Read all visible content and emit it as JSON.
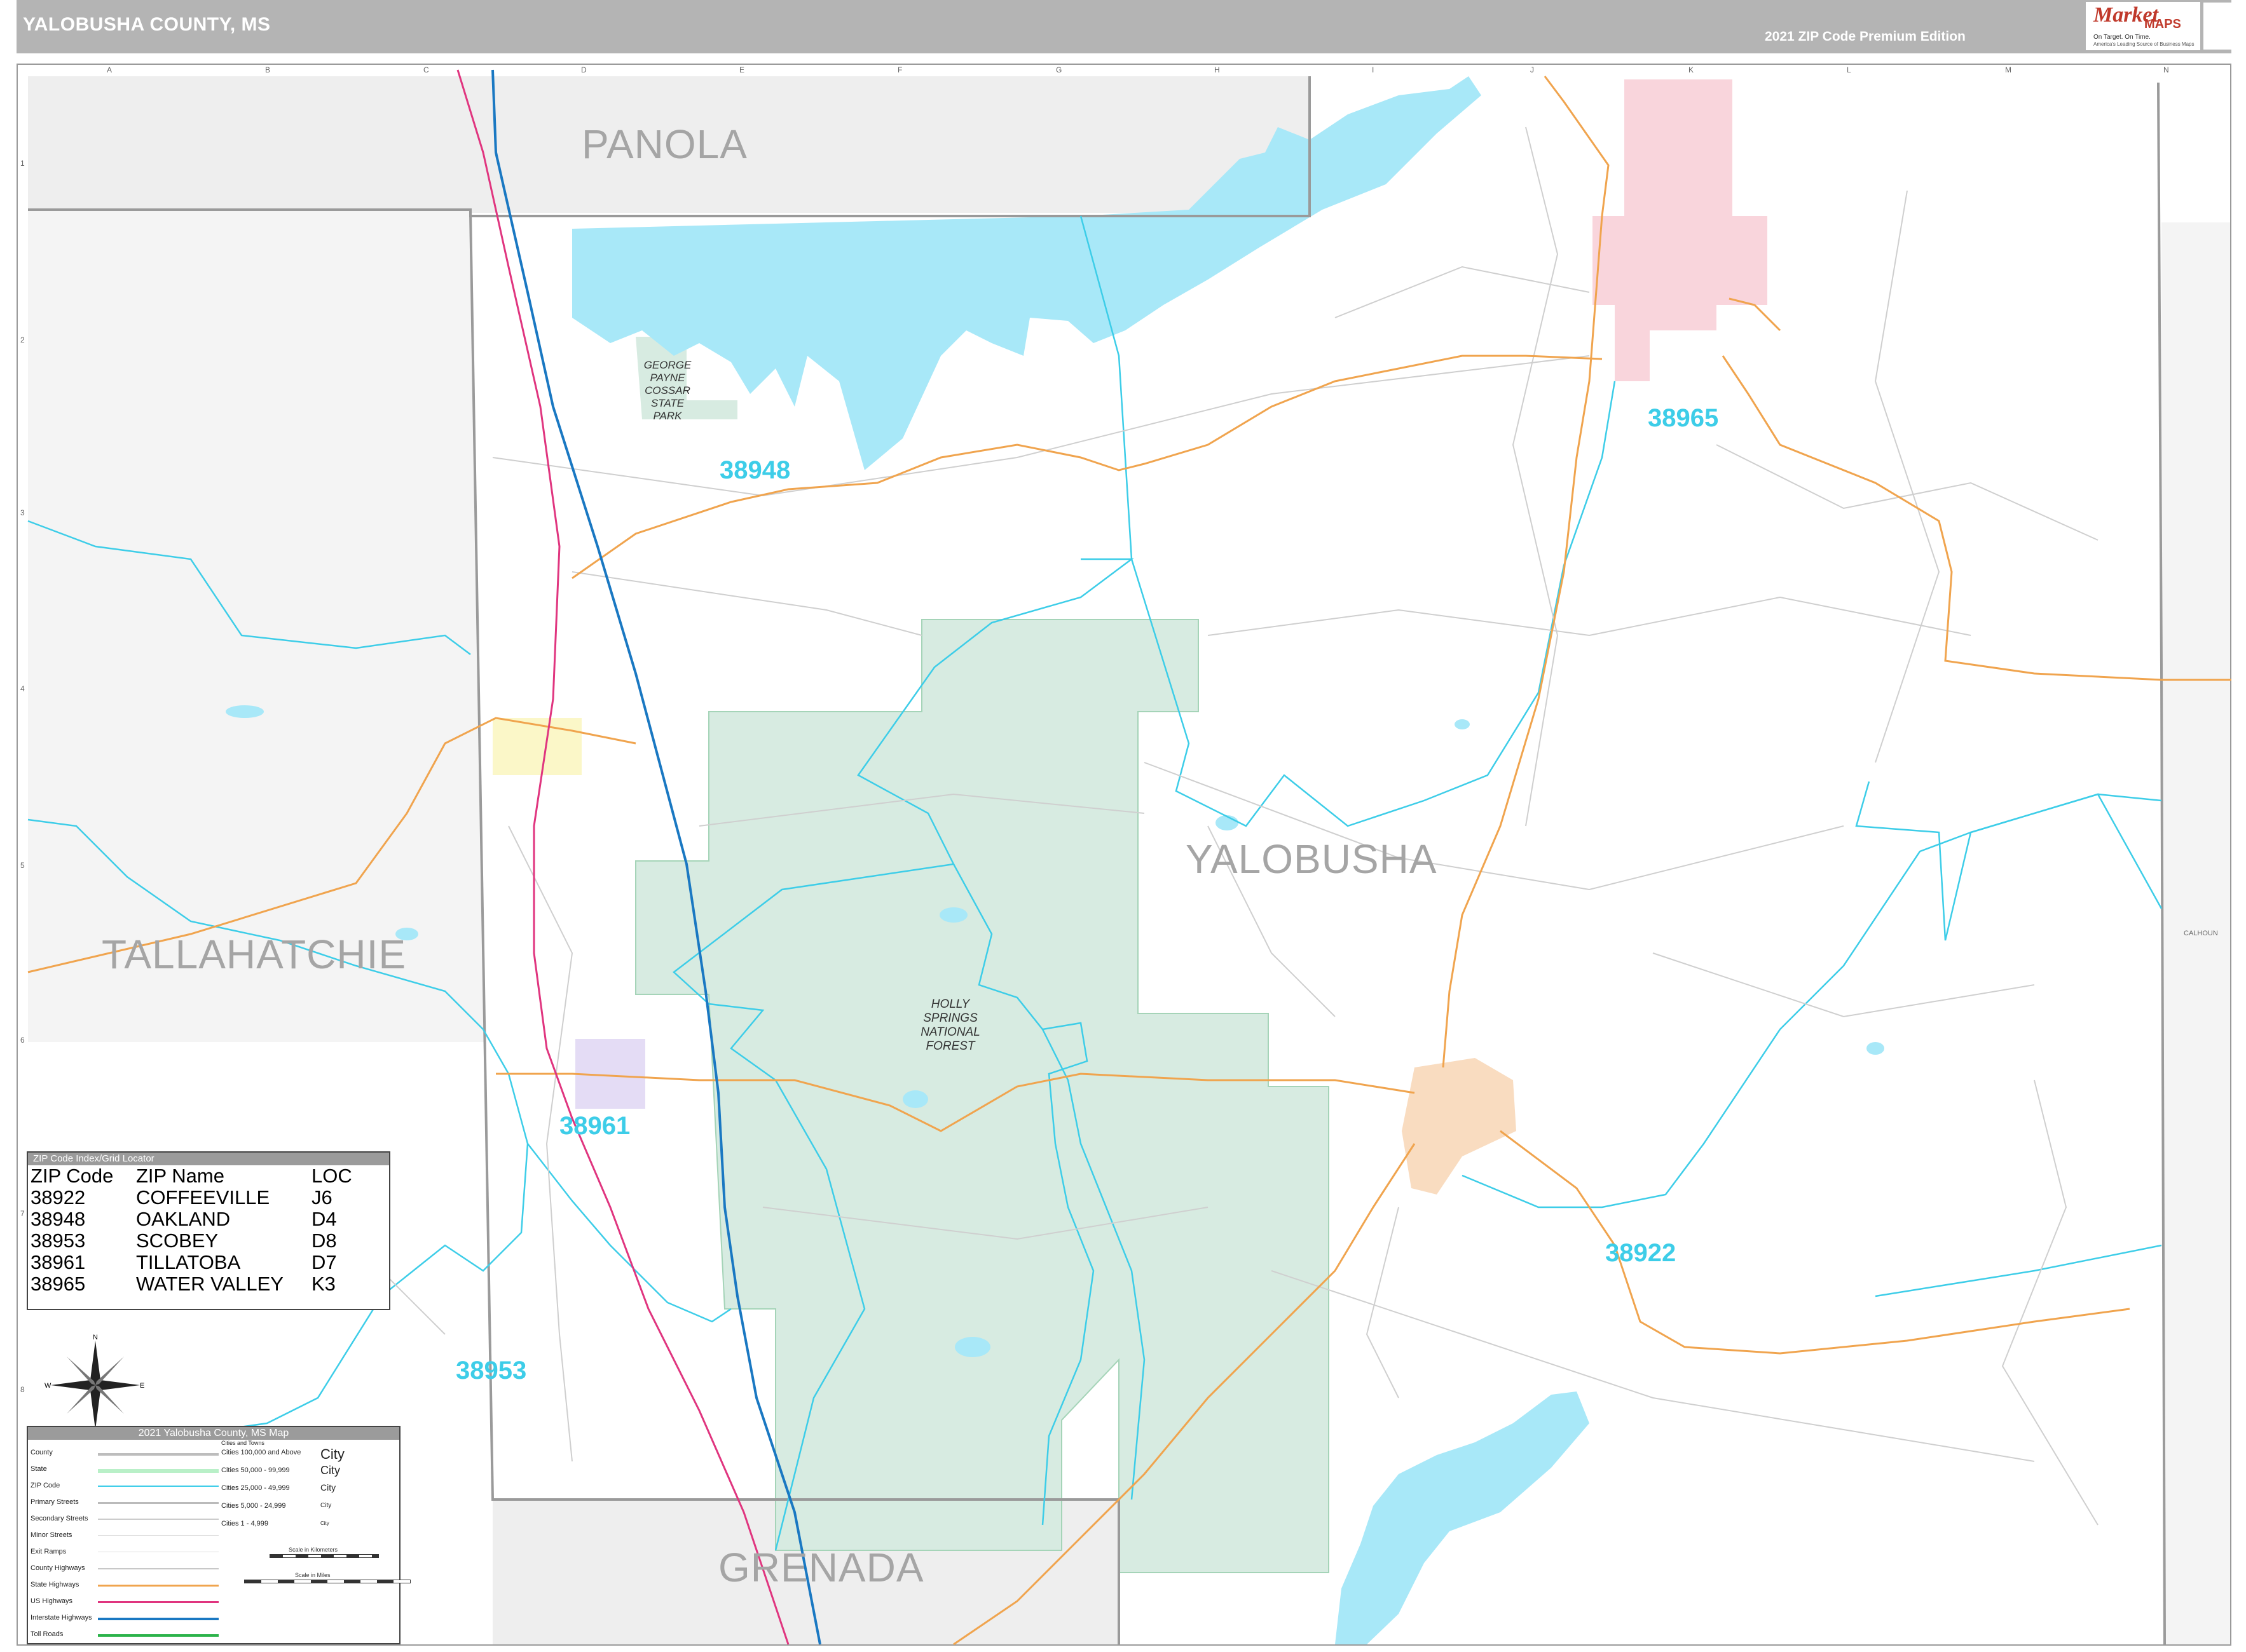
{
  "header": {
    "title": "YALOBUSHA COUNTY, MS",
    "edition": "2021 ZIP Code Premium Edition"
  },
  "logo": {
    "name_part1": "Market",
    "name_part2": "MAPS",
    "tagline": "On Target. On Time.",
    "subline": "America's Leading Source of Business Maps",
    "brand_color": "#c0392b"
  },
  "grid": {
    "columns": [
      "A",
      "B",
      "C",
      "D",
      "E",
      "F",
      "G",
      "H",
      "I",
      "J",
      "K",
      "L",
      "M",
      "N"
    ],
    "rows": [
      "1",
      "2",
      "3",
      "4",
      "5",
      "6",
      "7",
      "8"
    ]
  },
  "map": {
    "counties": {
      "panola": "PANOLA",
      "tallahatchie": "TALLAHATCHIE",
      "yalobusha": "YALOBUSHA",
      "grenada": "GRENADA",
      "calhoun": "CALHOUN"
    },
    "zip_labels": {
      "z38948": "38948",
      "z38965": "38965",
      "z38961": "38961",
      "z38922": "38922",
      "z38953": "38953"
    },
    "parks": {
      "cossar": "GEORGE\nPAYNE\nCOSSAR\nSTATE\nPARK",
      "holly_springs": "HOLLY\nSPRINGS\nNATIONAL\nFOREST"
    },
    "colors": {
      "water": "#a8e8f8",
      "forest": "#d7ebe1",
      "zip_boundary": "#3dcde8",
      "interstate": "#1a78c2",
      "us_highway": "#e0357f",
      "state_highway": "#f0a44e",
      "county_line": "#9a9a9a",
      "water_valley": "#f9d5dc",
      "coffeeville": "#f9dcc0",
      "oakland": "#fbf7c8",
      "tillatoba": "#e4dcf5"
    }
  },
  "zip_index": {
    "title": "ZIP Code Index/Grid Locator",
    "headers": [
      "ZIP Code",
      "ZIP Name",
      "LOC"
    ],
    "rows": [
      [
        "38922",
        "COFFEEVILLE",
        "J6"
      ],
      [
        "38948",
        "OAKLAND",
        "D4"
      ],
      [
        "38953",
        "SCOBEY",
        "D8"
      ],
      [
        "38961",
        "TILLATOBA",
        "D7"
      ],
      [
        "38965",
        "WATER VALLEY",
        "K3"
      ]
    ]
  },
  "legend": {
    "title": "2021 Yalobusha County, MS Map",
    "items": [
      "County",
      "State",
      "ZIP Code",
      "Primary Streets",
      "Secondary Streets",
      "Minor Streets",
      "Exit Ramps",
      "County Highways",
      "State Highways",
      "US Highways",
      "Interstate Highways",
      "Toll Roads"
    ],
    "cities_title": "Cities and Towns",
    "cities": [
      {
        "label": "Cities 100,000 and Above",
        "sample": "City"
      },
      {
        "label": "Cities 50,000 - 99,999",
        "sample": "City"
      },
      {
        "label": "Cities 25,000 - 49,999",
        "sample": "City"
      },
      {
        "label": "Cities 5,000 - 24,999",
        "sample": "City"
      },
      {
        "label": "Cities 1 - 4,999",
        "sample": "City"
      }
    ],
    "scale_km": "Scale in Kilometers",
    "scale_mi": "Scale in Miles"
  },
  "compass": {
    "n": "N",
    "s": "S",
    "e": "E",
    "w": "W"
  }
}
